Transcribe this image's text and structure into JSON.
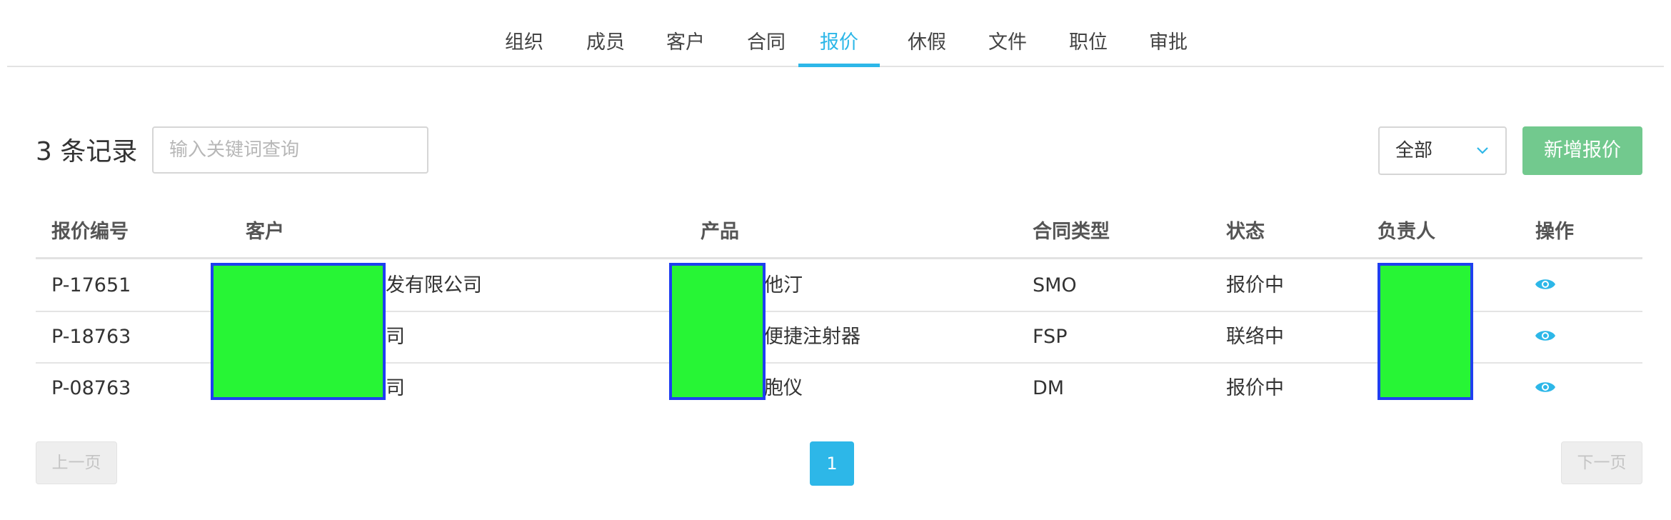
{
  "nav": {
    "tabs": [
      {
        "label": "组织",
        "active": false
      },
      {
        "label": "成员",
        "active": false
      },
      {
        "label": "客户",
        "active": false
      },
      {
        "label": "合同",
        "active": false
      },
      {
        "label": "报价",
        "active": true
      },
      {
        "label": "休假",
        "active": false
      },
      {
        "label": "文件",
        "active": false
      },
      {
        "label": "职位",
        "active": false
      },
      {
        "label": "审批",
        "active": false
      }
    ]
  },
  "toolbar": {
    "record_count": "3 条记录",
    "search_placeholder": "输入关键词查询",
    "search_value": "",
    "filter_value": "全部",
    "add_label": "新增报价"
  },
  "table": {
    "columns": [
      "报价编号",
      "客户",
      "产品",
      "合同类型",
      "状态",
      "负责人",
      "操作"
    ],
    "rows": [
      {
        "id": "P-17651",
        "customer": "发有限公司",
        "product": "他汀",
        "contract_type": "SMO",
        "status": "报价中",
        "owner": "",
        "action_icon": "eye-icon"
      },
      {
        "id": "P-18763",
        "customer": "司",
        "product": "便捷注射器",
        "contract_type": "FSP",
        "status": "联络中",
        "owner": "",
        "action_icon": "eye-icon"
      },
      {
        "id": "P-08763",
        "customer": "司",
        "product": "胞仪",
        "contract_type": "DM",
        "status": "报价中",
        "owner": "",
        "action_icon": "eye-icon"
      }
    ]
  },
  "pagination": {
    "prev_label": "上一页",
    "current_page": "1",
    "next_label": "下一页"
  },
  "colors": {
    "accent": "#2db7e8",
    "add_button": "#72c98e",
    "redaction_fill": "#27f535",
    "redaction_border": "#1f3ff0"
  }
}
